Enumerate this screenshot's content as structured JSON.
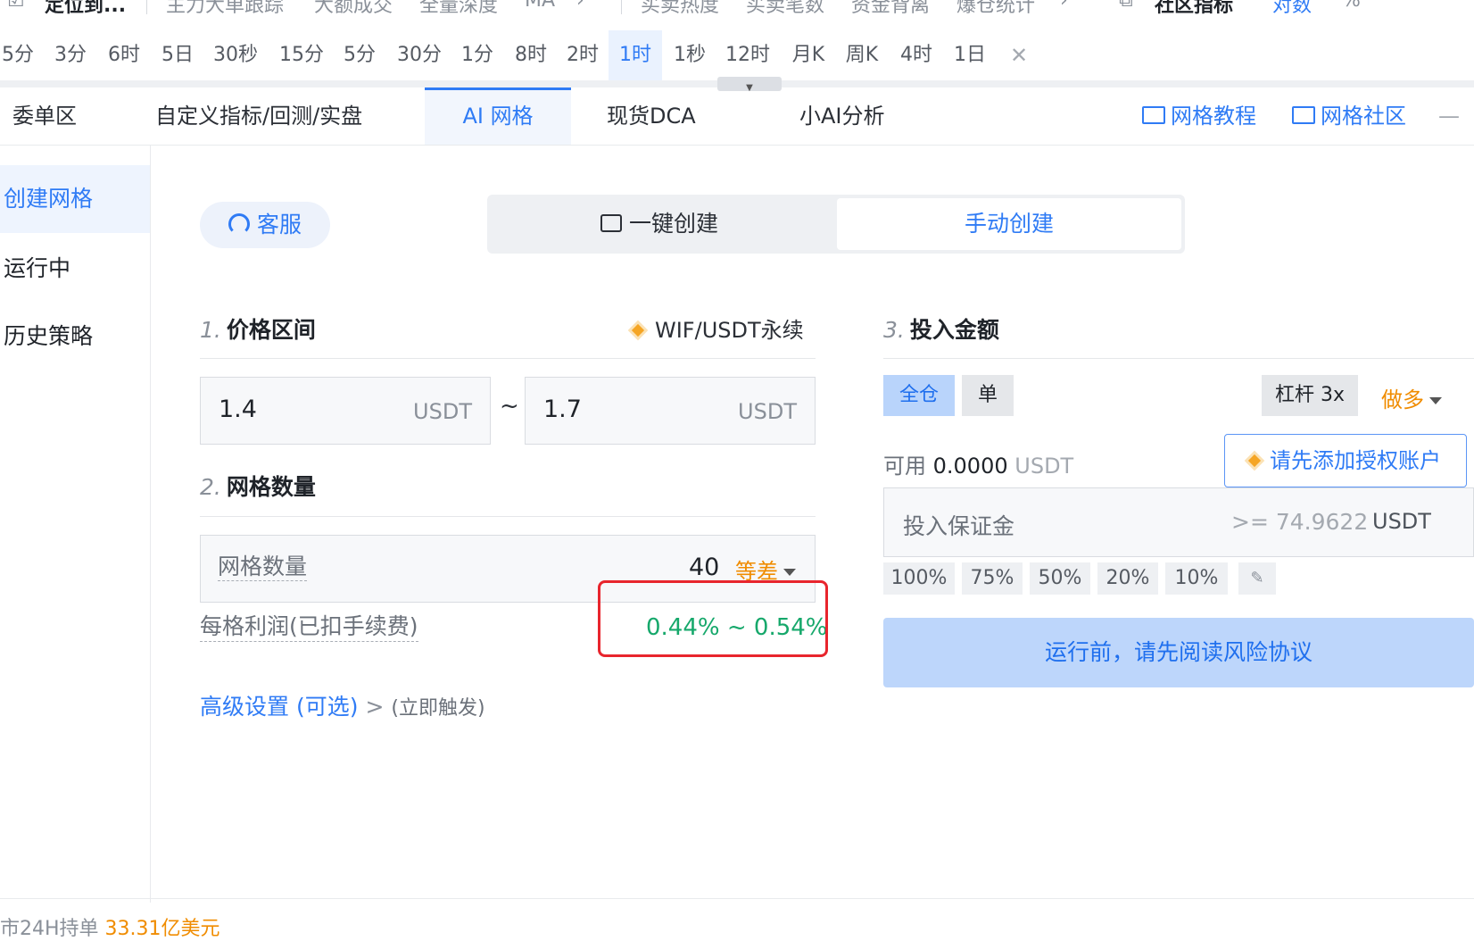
{
  "top_strip": {
    "items": [
      "定位到...",
      "主力大单跟踪",
      "大额成交",
      "全量深度",
      "MA",
      "买卖热度",
      "买卖笔数",
      "资金背离",
      "爆仓统计",
      "社区指标",
      "对数",
      "%"
    ]
  },
  "timeframes": [
    "5分",
    "3分",
    "6时",
    "5日",
    "30秒",
    "15分",
    "5分",
    "30分",
    "1分",
    "8时",
    "2时",
    "1时",
    "1秒",
    "12时",
    "月K",
    "周K",
    "4时",
    "1日"
  ],
  "timeframe_active": "1时",
  "tabs": [
    "委单区",
    "自定义指标/回测/实盘",
    "AI 网格",
    "现货DCA",
    "小AI分析"
  ],
  "tab_links": [
    "网格教程",
    "网格社区"
  ],
  "leftnav": [
    "创建网格",
    "运行中",
    "历史策略"
  ],
  "service_button": "客服",
  "create_modes": [
    "一键创建",
    "手动创建"
  ],
  "section1": {
    "num": "1.",
    "title": "价格区间",
    "pair": "WIF/USDT永续"
  },
  "price_range": {
    "low": "1.4",
    "high": "1.7",
    "unit": "USDT",
    "separator": "~"
  },
  "section2": {
    "num": "2.",
    "title": "网格数量"
  },
  "grid": {
    "label": "网格数量",
    "count": "40",
    "mode": "等差"
  },
  "profit": {
    "label": "每格利润(已扣手续费)",
    "value": "0.44% ~ 0.54%"
  },
  "advanced": {
    "label": "高级设置 (可选)",
    "chevron": ">",
    "hint": "(立即触发)"
  },
  "section3": {
    "num": "3.",
    "title": "投入金额"
  },
  "margin_mode": {
    "cross": "全仓",
    "isolated": "单"
  },
  "leverage": "杠杆 3x",
  "side": "做多",
  "available": {
    "label": "可用",
    "amount": "0.0000",
    "unit": "USDT"
  },
  "auth_button": "请先添加授权账户",
  "margin_input": {
    "placeholder": "投入保证金",
    "min": ">= 74.9622",
    "unit": "USDT"
  },
  "percentages": [
    "100%",
    "75%",
    "50%",
    "20%",
    "10%"
  ],
  "run_button": "运行前，请先阅读风险协议",
  "bottom_clip": {
    "text": "市24H持单",
    "value": "33.31亿美元"
  },
  "colors": {
    "accent": "#2f7bf5",
    "profit_green": "#16a86b",
    "orange": "#f08c00",
    "highlight_red": "#e8252d"
  }
}
